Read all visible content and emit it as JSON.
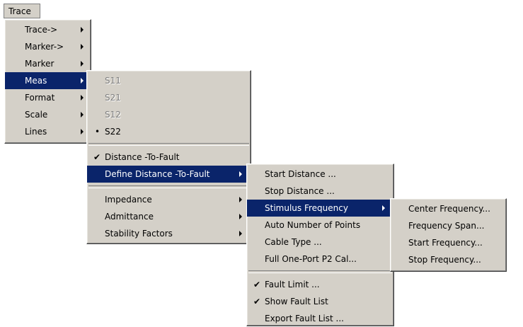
{
  "menubar": {
    "trace_label": "Trace"
  },
  "trace_menu": [
    {
      "label": "Trace->"
    },
    {
      "label": "Marker->"
    },
    {
      "label": "Marker"
    },
    {
      "label": "Meas"
    },
    {
      "label": "Format"
    },
    {
      "label": "Scale"
    },
    {
      "label": "Lines"
    }
  ],
  "meas_menu": {
    "s11": "S11",
    "s21": "S21",
    "s12": "S12",
    "s22": "S22",
    "distance_to_fault": "Distance -To-Fault",
    "define_dtf": "Define Distance -To-Fault",
    "impedance": "Impedance",
    "admittance": "Admittance",
    "stability": "Stability Factors"
  },
  "dtf_menu": {
    "start_distance": "Start Distance ...",
    "stop_distance": "Stop Distance ...",
    "stimulus_frequency": "Stimulus Frequency",
    "auto_points": "Auto Number of Points",
    "cable_type": "Cable Type ...",
    "full_cal": "Full One-Port P2 Cal...",
    "fault_limit": "Fault Limit ...",
    "show_fault_list": "Show Fault List",
    "export_fault_list": "Export Fault List ..."
  },
  "stimulus_menu": {
    "center": "Center Frequency...",
    "span": "Frequency Span...",
    "start": "Start Frequency...",
    "stop": "Stop Frequency..."
  },
  "glyphs": {
    "check": "✔",
    "bullet": "•"
  },
  "colors": {
    "menu_bg": "#d4d0c8",
    "highlight": "#0a246a",
    "disabled": "#808080"
  }
}
